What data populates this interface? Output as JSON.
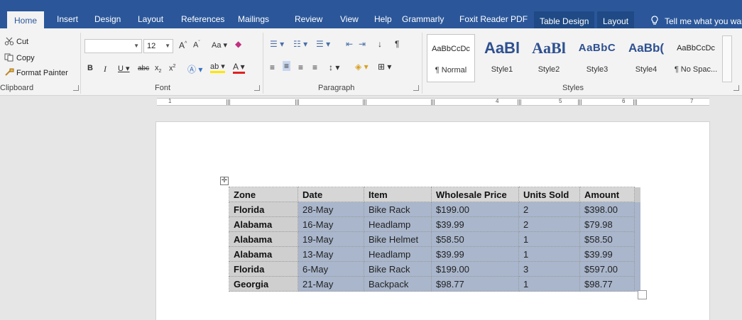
{
  "ribbon_tabs": {
    "home": "Home",
    "insert": "Insert",
    "design": "Design",
    "layout": "Layout",
    "references": "References",
    "mailings": "Mailings",
    "review": "Review",
    "view": "View",
    "help": "Help",
    "grammarly": "Grammarly",
    "foxit": "Foxit Reader PDF",
    "table_design": "Table Design",
    "table_layout": "Layout",
    "tell_me": "Tell me what you war"
  },
  "clipboard": {
    "cut": "Cut",
    "copy": "Copy",
    "format_painter": "Format Painter",
    "label": "Clipboard"
  },
  "font": {
    "family": "",
    "size": "12",
    "label": "Font"
  },
  "paragraph": {
    "label": "Paragraph"
  },
  "styles": {
    "label": "Styles",
    "items": [
      {
        "preview": "AaBbCcDc",
        "name": "¶ Normal"
      },
      {
        "preview": "AaBl",
        "name": "Style1"
      },
      {
        "preview": "AaBl",
        "name": "Style2"
      },
      {
        "preview": "AaBbC",
        "name": "Style3"
      },
      {
        "preview": "AaBb(",
        "name": "Style4"
      },
      {
        "preview": "AaBbCcDc",
        "name": "¶ No Spac..."
      }
    ]
  },
  "ruler": {
    "numbers": [
      "1",
      "4",
      "5",
      "6",
      "7"
    ]
  },
  "table": {
    "headers": [
      "Zone",
      "Date",
      "Item",
      "Wholesale Price",
      "Units Sold",
      "Amount"
    ],
    "rows": [
      [
        "Florida",
        "28-May",
        "Bike Rack",
        "$199.00",
        "2",
        "$398.00"
      ],
      [
        "Alabama",
        "16-May",
        "Headlamp",
        "$39.99",
        "2",
        "$79.98"
      ],
      [
        "Alabama",
        "19-May",
        "Bike Helmet",
        "$58.50",
        "1",
        "$58.50"
      ],
      [
        "Alabama",
        "13-May",
        "Headlamp",
        "$39.99",
        "1",
        "$39.99"
      ],
      [
        "Florida",
        "6-May",
        "Bike Rack",
        "$199.00",
        "3",
        "$597.00"
      ],
      [
        "Georgia",
        "21-May",
        "Backpack",
        "$98.77",
        "1",
        "$98.77"
      ]
    ]
  },
  "colors": {
    "ribbon_blue": "#2b579a",
    "table_body": "#a9b6cc",
    "table_header": "#d6d6d6"
  }
}
